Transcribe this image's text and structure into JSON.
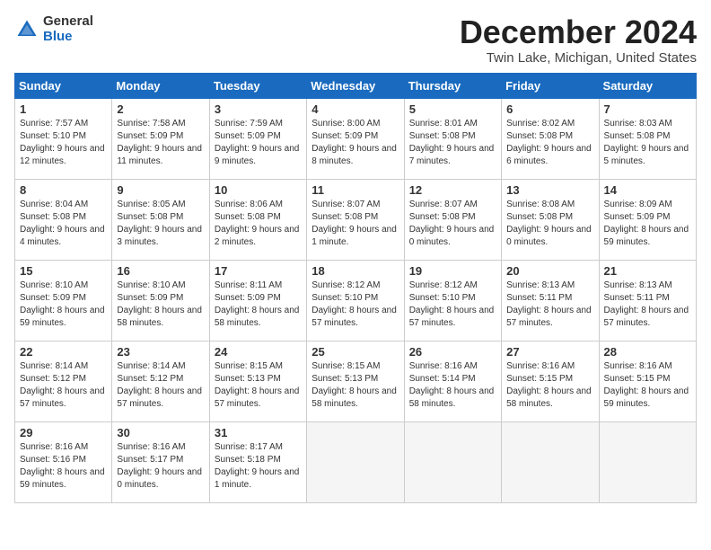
{
  "logo": {
    "general": "General",
    "blue": "Blue"
  },
  "header": {
    "title": "December 2024",
    "subtitle": "Twin Lake, Michigan, United States"
  },
  "weekdays": [
    "Sunday",
    "Monday",
    "Tuesday",
    "Wednesday",
    "Thursday",
    "Friday",
    "Saturday"
  ],
  "weeks": [
    [
      {
        "day": "1",
        "sunrise": "Sunrise: 7:57 AM",
        "sunset": "Sunset: 5:10 PM",
        "daylight": "Daylight: 9 hours and 12 minutes."
      },
      {
        "day": "2",
        "sunrise": "Sunrise: 7:58 AM",
        "sunset": "Sunset: 5:09 PM",
        "daylight": "Daylight: 9 hours and 11 minutes."
      },
      {
        "day": "3",
        "sunrise": "Sunrise: 7:59 AM",
        "sunset": "Sunset: 5:09 PM",
        "daylight": "Daylight: 9 hours and 9 minutes."
      },
      {
        "day": "4",
        "sunrise": "Sunrise: 8:00 AM",
        "sunset": "Sunset: 5:09 PM",
        "daylight": "Daylight: 9 hours and 8 minutes."
      },
      {
        "day": "5",
        "sunrise": "Sunrise: 8:01 AM",
        "sunset": "Sunset: 5:08 PM",
        "daylight": "Daylight: 9 hours and 7 minutes."
      },
      {
        "day": "6",
        "sunrise": "Sunrise: 8:02 AM",
        "sunset": "Sunset: 5:08 PM",
        "daylight": "Daylight: 9 hours and 6 minutes."
      },
      {
        "day": "7",
        "sunrise": "Sunrise: 8:03 AM",
        "sunset": "Sunset: 5:08 PM",
        "daylight": "Daylight: 9 hours and 5 minutes."
      }
    ],
    [
      {
        "day": "8",
        "sunrise": "Sunrise: 8:04 AM",
        "sunset": "Sunset: 5:08 PM",
        "daylight": "Daylight: 9 hours and 4 minutes."
      },
      {
        "day": "9",
        "sunrise": "Sunrise: 8:05 AM",
        "sunset": "Sunset: 5:08 PM",
        "daylight": "Daylight: 9 hours and 3 minutes."
      },
      {
        "day": "10",
        "sunrise": "Sunrise: 8:06 AM",
        "sunset": "Sunset: 5:08 PM",
        "daylight": "Daylight: 9 hours and 2 minutes."
      },
      {
        "day": "11",
        "sunrise": "Sunrise: 8:07 AM",
        "sunset": "Sunset: 5:08 PM",
        "daylight": "Daylight: 9 hours and 1 minute."
      },
      {
        "day": "12",
        "sunrise": "Sunrise: 8:07 AM",
        "sunset": "Sunset: 5:08 PM",
        "daylight": "Daylight: 9 hours and 0 minutes."
      },
      {
        "day": "13",
        "sunrise": "Sunrise: 8:08 AM",
        "sunset": "Sunset: 5:08 PM",
        "daylight": "Daylight: 9 hours and 0 minutes."
      },
      {
        "day": "14",
        "sunrise": "Sunrise: 8:09 AM",
        "sunset": "Sunset: 5:09 PM",
        "daylight": "Daylight: 8 hours and 59 minutes."
      }
    ],
    [
      {
        "day": "15",
        "sunrise": "Sunrise: 8:10 AM",
        "sunset": "Sunset: 5:09 PM",
        "daylight": "Daylight: 8 hours and 59 minutes."
      },
      {
        "day": "16",
        "sunrise": "Sunrise: 8:10 AM",
        "sunset": "Sunset: 5:09 PM",
        "daylight": "Daylight: 8 hours and 58 minutes."
      },
      {
        "day": "17",
        "sunrise": "Sunrise: 8:11 AM",
        "sunset": "Sunset: 5:09 PM",
        "daylight": "Daylight: 8 hours and 58 minutes."
      },
      {
        "day": "18",
        "sunrise": "Sunrise: 8:12 AM",
        "sunset": "Sunset: 5:10 PM",
        "daylight": "Daylight: 8 hours and 57 minutes."
      },
      {
        "day": "19",
        "sunrise": "Sunrise: 8:12 AM",
        "sunset": "Sunset: 5:10 PM",
        "daylight": "Daylight: 8 hours and 57 minutes."
      },
      {
        "day": "20",
        "sunrise": "Sunrise: 8:13 AM",
        "sunset": "Sunset: 5:11 PM",
        "daylight": "Daylight: 8 hours and 57 minutes."
      },
      {
        "day": "21",
        "sunrise": "Sunrise: 8:13 AM",
        "sunset": "Sunset: 5:11 PM",
        "daylight": "Daylight: 8 hours and 57 minutes."
      }
    ],
    [
      {
        "day": "22",
        "sunrise": "Sunrise: 8:14 AM",
        "sunset": "Sunset: 5:12 PM",
        "daylight": "Daylight: 8 hours and 57 minutes."
      },
      {
        "day": "23",
        "sunrise": "Sunrise: 8:14 AM",
        "sunset": "Sunset: 5:12 PM",
        "daylight": "Daylight: 8 hours and 57 minutes."
      },
      {
        "day": "24",
        "sunrise": "Sunrise: 8:15 AM",
        "sunset": "Sunset: 5:13 PM",
        "daylight": "Daylight: 8 hours and 57 minutes."
      },
      {
        "day": "25",
        "sunrise": "Sunrise: 8:15 AM",
        "sunset": "Sunset: 5:13 PM",
        "daylight": "Daylight: 8 hours and 58 minutes."
      },
      {
        "day": "26",
        "sunrise": "Sunrise: 8:16 AM",
        "sunset": "Sunset: 5:14 PM",
        "daylight": "Daylight: 8 hours and 58 minutes."
      },
      {
        "day": "27",
        "sunrise": "Sunrise: 8:16 AM",
        "sunset": "Sunset: 5:15 PM",
        "daylight": "Daylight: 8 hours and 58 minutes."
      },
      {
        "day": "28",
        "sunrise": "Sunrise: 8:16 AM",
        "sunset": "Sunset: 5:15 PM",
        "daylight": "Daylight: 8 hours and 59 minutes."
      }
    ],
    [
      {
        "day": "29",
        "sunrise": "Sunrise: 8:16 AM",
        "sunset": "Sunset: 5:16 PM",
        "daylight": "Daylight: 8 hours and 59 minutes."
      },
      {
        "day": "30",
        "sunrise": "Sunrise: 8:16 AM",
        "sunset": "Sunset: 5:17 PM",
        "daylight": "Daylight: 9 hours and 0 minutes."
      },
      {
        "day": "31",
        "sunrise": "Sunrise: 8:17 AM",
        "sunset": "Sunset: 5:18 PM",
        "daylight": "Daylight: 9 hours and 1 minute."
      },
      null,
      null,
      null,
      null
    ]
  ]
}
